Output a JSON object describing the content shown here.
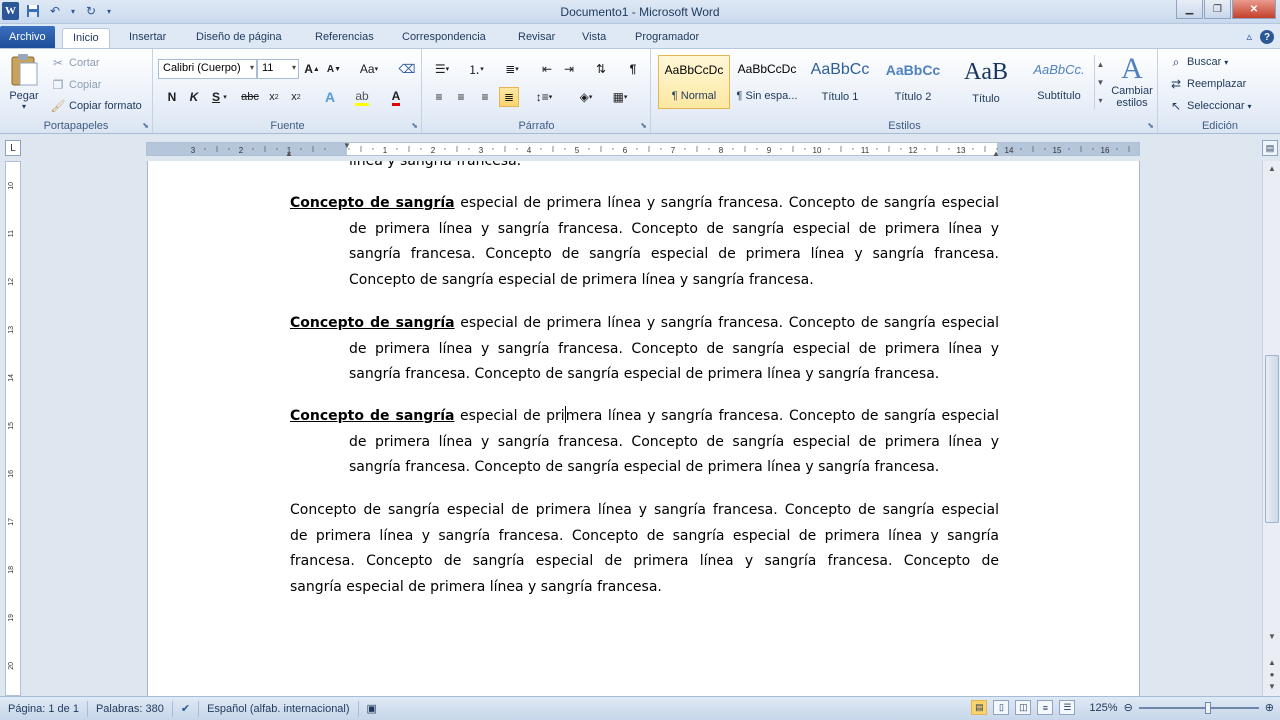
{
  "window": {
    "title": "Documento1  -  Microsoft Word"
  },
  "qat": {
    "logo": "W",
    "save_icon": "save-icon",
    "undo_icon": "undo-icon",
    "redo_icon": "redo-icon"
  },
  "tabs": [
    {
      "label": "Archivo"
    },
    {
      "label": "Inicio"
    },
    {
      "label": "Insertar"
    },
    {
      "label": "Diseño de página"
    },
    {
      "label": "Referencias"
    },
    {
      "label": "Correspondencia"
    },
    {
      "label": "Revisar"
    },
    {
      "label": "Vista"
    },
    {
      "label": "Programador"
    }
  ],
  "ribbon": {
    "clipboard": {
      "group_label": "Portapapeles",
      "paste": "Pegar",
      "cut": "Cortar",
      "copy": "Copiar",
      "format_painter": "Copiar formato"
    },
    "font": {
      "group_label": "Fuente",
      "font_name": "Calibri (Cuerpo)",
      "font_size": "11"
    },
    "paragraph": {
      "group_label": "Párrafo"
    },
    "styles": {
      "group_label": "Estilos",
      "items": [
        {
          "preview": "AaBbCcDc",
          "name": "¶ Normal"
        },
        {
          "preview": "AaBbCcDc",
          "name": "¶ Sin espa..."
        },
        {
          "preview": "AaBbCc",
          "name": "Título 1"
        },
        {
          "preview": "AaBbCc",
          "name": "Título 2"
        },
        {
          "preview": "AaB",
          "name": "Título"
        },
        {
          "preview": "AaBbCc.",
          "name": "Subtítulo"
        }
      ],
      "change_styles": "Cambiar estilos"
    },
    "editing": {
      "group_label": "Edición",
      "find": "Buscar",
      "replace": "Reemplazar",
      "select": "Seleccionar"
    }
  },
  "ruler": {
    "h_numbers": [
      "3",
      "2",
      "1",
      "1",
      "2",
      "3",
      "4",
      "5",
      "6",
      "7",
      "8",
      "9",
      "10",
      "11",
      "12",
      "13",
      "14",
      "15",
      "16",
      "17"
    ],
    "v_numbers": [
      "10",
      "11",
      "12",
      "13",
      "14",
      "15",
      "16",
      "17",
      "18",
      "19",
      "20"
    ]
  },
  "document": {
    "top_fragment": "línea y sangría francesa.",
    "lead": "Concepto de sangría",
    "para1": [
      " especial de primera línea y sangría francesa. Concepto de sangría especial",
      "de primera línea y sangría francesa. Concepto de sangría especial de primera línea y",
      "sangría francesa. Concepto de sangría especial de primera línea y sangría francesa.",
      "Concepto de sangría especial de primera línea y sangría francesa."
    ],
    "para2": [
      " especial de primera línea y sangría francesa. Concepto de sangría especial",
      "de primera línea y sangría francesa. Concepto de sangría especial de primera línea y",
      "sangría francesa. Concepto de sangría especial de primera línea y sangría francesa."
    ],
    "para3_pre": " especial de pri",
    "para3_post": "mera línea y sangría francesa. Concepto de sangría especial",
    "para3": [
      "de primera línea y sangría francesa. Concepto de sangría especial de primera línea y",
      "sangría francesa. Concepto de sangría especial de primera línea y sangría francesa."
    ],
    "para4": [
      "Concepto de sangría especial de primera línea y sangría francesa. Concepto de sangría especial",
      "de primera línea y sangría francesa. Concepto de sangría especial de primera línea y sangría",
      "francesa. Concepto de sangría especial de primera línea y sangría francesa. Concepto de",
      "sangría especial de primera línea y sangría francesa."
    ]
  },
  "status": {
    "page": "Página: 1 de 1",
    "words": "Palabras: 380",
    "language": "Español (alfab. internacional)",
    "zoom": "125%"
  },
  "colors": {
    "accent": "#2b5797",
    "ribbon_bg": "#dfe9f5",
    "selected": "#fbd46e"
  }
}
